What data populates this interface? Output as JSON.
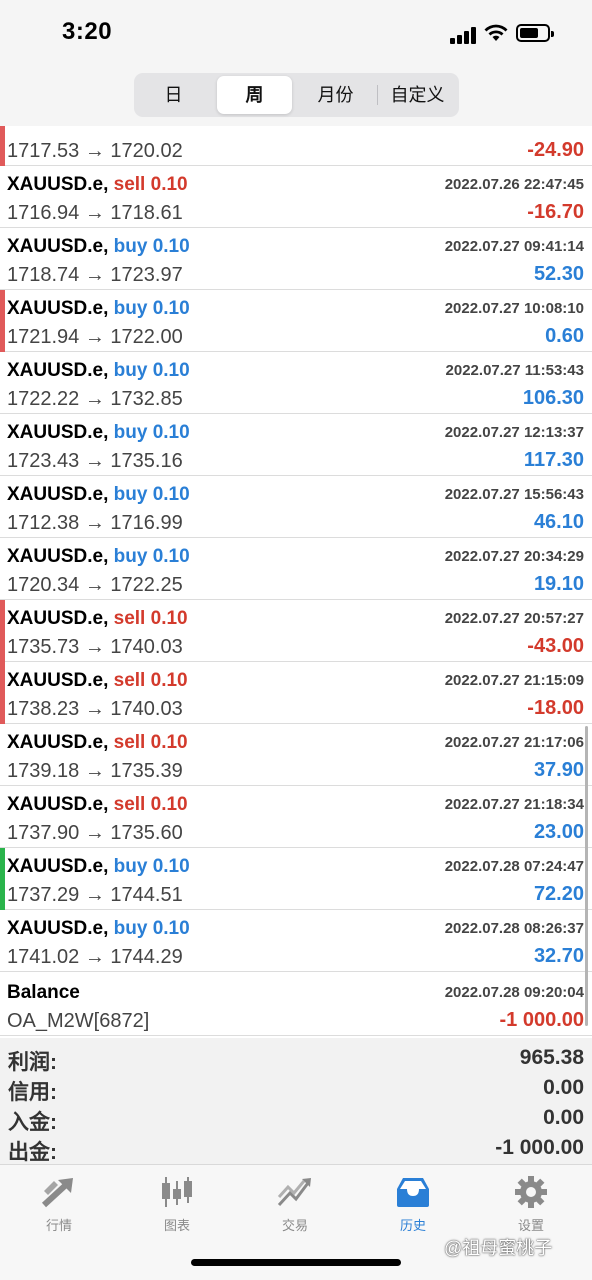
{
  "status": {
    "time": "3:20"
  },
  "segments": [
    "日",
    "周",
    "月份",
    "自定义"
  ],
  "partial_row": {
    "prices": "1717.53 → 1720.02",
    "profit": "-24.90"
  },
  "trades": [
    {
      "symbol": "XAUUSD.e,",
      "side": "sell",
      "lot": "0.10",
      "datetime": "2022.07.26 22:47:45",
      "prices": "1716.94 → 1718.61",
      "profit": "-16.70"
    },
    {
      "symbol": "XAUUSD.e,",
      "side": "buy",
      "lot": "0.10",
      "datetime": "2022.07.27 09:41:14",
      "prices": "1718.74 → 1723.97",
      "profit": "52.30"
    },
    {
      "symbol": "XAUUSD.e,",
      "side": "buy",
      "lot": "0.10",
      "datetime": "2022.07.27 10:08:10",
      "prices": "1721.94 → 1722.00",
      "profit": "0.60"
    },
    {
      "symbol": "XAUUSD.e,",
      "side": "buy",
      "lot": "0.10",
      "datetime": "2022.07.27 11:53:43",
      "prices": "1722.22 → 1732.85",
      "profit": "106.30"
    },
    {
      "symbol": "XAUUSD.e,",
      "side": "buy",
      "lot": "0.10",
      "datetime": "2022.07.27 12:13:37",
      "prices": "1723.43 → 1735.16",
      "profit": "117.30"
    },
    {
      "symbol": "XAUUSD.e,",
      "side": "buy",
      "lot": "0.10",
      "datetime": "2022.07.27 15:56:43",
      "prices": "1712.38 → 1716.99",
      "profit": "46.10"
    },
    {
      "symbol": "XAUUSD.e,",
      "side": "buy",
      "lot": "0.10",
      "datetime": "2022.07.27 20:34:29",
      "prices": "1720.34 → 1722.25",
      "profit": "19.10"
    },
    {
      "symbol": "XAUUSD.e,",
      "side": "sell",
      "lot": "0.10",
      "datetime": "2022.07.27 20:57:27",
      "prices": "1735.73 → 1740.03",
      "profit": "-43.00"
    },
    {
      "symbol": "XAUUSD.e,",
      "side": "sell",
      "lot": "0.10",
      "datetime": "2022.07.27 21:15:09",
      "prices": "1738.23 → 1740.03",
      "profit": "-18.00"
    },
    {
      "symbol": "XAUUSD.e,",
      "side": "sell",
      "lot": "0.10",
      "datetime": "2022.07.27 21:17:06",
      "prices": "1739.18 → 1735.39",
      "profit": "37.90"
    },
    {
      "symbol": "XAUUSD.e,",
      "side": "sell",
      "lot": "0.10",
      "datetime": "2022.07.27 21:18:34",
      "prices": "1737.90 → 1735.60",
      "profit": "23.00"
    },
    {
      "symbol": "XAUUSD.e,",
      "side": "buy",
      "lot": "0.10",
      "datetime": "2022.07.28 07:24:47",
      "prices": "1737.29 → 1744.51",
      "profit": "72.20"
    },
    {
      "symbol": "XAUUSD.e,",
      "side": "buy",
      "lot": "0.10",
      "datetime": "2022.07.28 08:26:37",
      "prices": "1741.02 → 1744.29",
      "profit": "32.70"
    }
  ],
  "balance": {
    "title": "Balance",
    "datetime": "2022.07.28 09:20:04",
    "comment": "OA_M2W[6872]",
    "amount": "-1 000.00"
  },
  "summary": [
    {
      "label": "利润:",
      "value": "965.38"
    },
    {
      "label": "信用:",
      "value": "0.00"
    },
    {
      "label": "入金:",
      "value": "0.00"
    },
    {
      "label": "出金:",
      "value": "-1 000.00"
    }
  ],
  "tabs": [
    {
      "label": "行情",
      "icon": "quotes-arrow-icon"
    },
    {
      "label": "图表",
      "icon": "candlestick-icon"
    },
    {
      "label": "交易",
      "icon": "trade-trend-icon"
    },
    {
      "label": "历史",
      "icon": "history-inbox-icon"
    },
    {
      "label": "设置",
      "icon": "gear-icon"
    }
  ],
  "active_tab": "历史",
  "watermark": "@祖母蜜桃子",
  "colors": {
    "sell": "#d33a2c",
    "buy": "#2a7fd6",
    "loss": "#d33a2c",
    "profit": "#2a7fd6",
    "accent": "#2a7fd6"
  }
}
